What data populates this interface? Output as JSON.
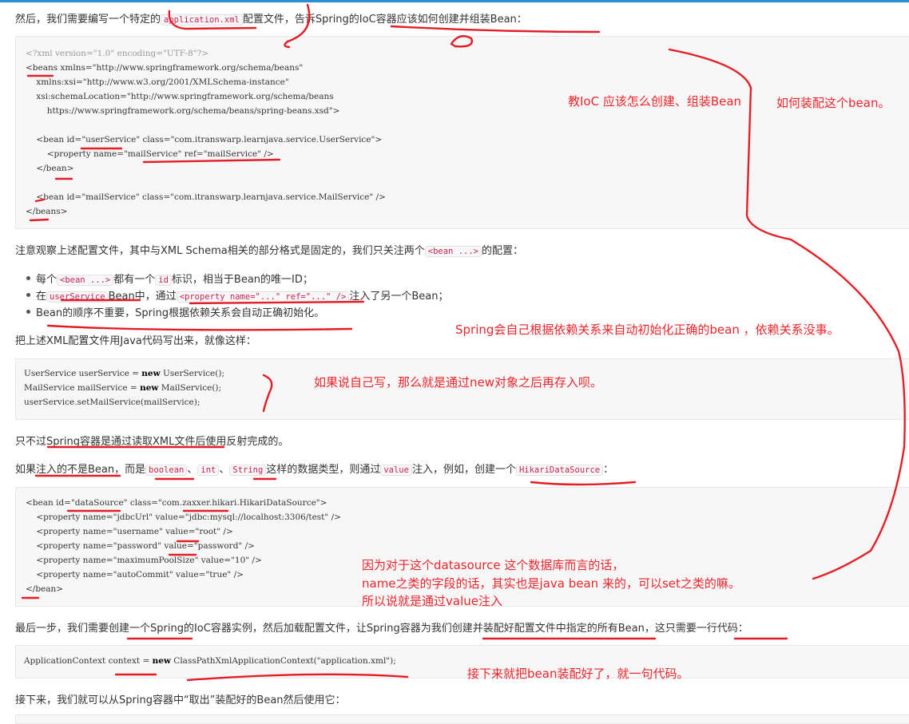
{
  "colors": {
    "accent": "#2c8fd6",
    "annotation": "#e41e26",
    "inline_code": "#c7254e"
  },
  "p1": {
    "pre": "然后，我们需要编写一个特定的",
    "code": "application.xml",
    "post": "配置文件，告诉Spring的IoC容器应该如何创建并组装Bean："
  },
  "xml1": [
    "<?xml version=\"1.0\" encoding=\"UTF-8\"?>",
    "<beans xmlns=\"http://www.springframework.org/schema/beans\"",
    "    xmlns:xsi=\"http://www.w3.org/2001/XMLSchema-instance\"",
    "    xsi:schemaLocation=\"http://www.springframework.org/schema/beans",
    "        https://www.springframework.org/schema/beans/spring-beans.xsd\">",
    "",
    "    <bean id=\"userService\" class=\"com.itranswarp.learnjava.service.UserService\">",
    "        <property name=\"mailService\" ref=\"mailService\" />",
    "    </bean>",
    "",
    "    <bean id=\"mailService\" class=\"com.itranswarp.learnjava.service.MailService\" />",
    "</beans>"
  ],
  "p2": {
    "pre": "注意观察上述配置文件，其中与XML Schema相关的部分格式是固定的，我们只关注两个",
    "code": "<bean ...>",
    "post": "的配置："
  },
  "bullets": {
    "b1": {
      "pre": "每个",
      "code1": "<bean ...>",
      "mid": "都有一个",
      "code2": "id",
      "post": "标识，相当于Bean的唯一ID；"
    },
    "b2": {
      "pre": "在",
      "code1": "userService",
      "mid": "Bean中，通过",
      "code2": "<property name=\"...\" ref=\"...\" />",
      "post": "注入了另一个Bean；"
    },
    "b3": {
      "text": "Bean的顺序不重要，Spring根据依赖关系会自动正确初始化。"
    }
  },
  "p3": {
    "text": "把上述XML配置文件用Java代码写出来，就像这样："
  },
  "java1": {
    "l1": {
      "a": "UserService userService = ",
      "kw": "new",
      "b": " UserService();"
    },
    "l2": {
      "a": "MailService mailService = ",
      "kw": "new",
      "b": " MailService();"
    },
    "l3": {
      "a": "userService.setMailService(mailService);"
    }
  },
  "p4": {
    "text": "只不过Spring容器是通过读取XML文件后使用反射完成的。"
  },
  "p5": {
    "pre": "如果注入的不是Bean，而是",
    "c1": "boolean",
    "s1": "、",
    "c2": "int",
    "s2": "、",
    "c3": "String",
    "mid": "这样的数据类型，则通过",
    "c4": "value",
    "mid2": "注入，例如，创建一个",
    "c5": "HikariDataSource",
    "post": "："
  },
  "xml2": [
    "<bean id=\"dataSource\" class=\"com.zaxxer.hikari.HikariDataSource\">",
    "    <property name=\"jdbcUrl\" value=\"jdbc:mysql://localhost:3306/test\" />",
    "    <property name=\"username\" value=\"root\" />",
    "    <property name=\"password\" value=\"password\" />",
    "    <property name=\"maximumPoolSize\" value=\"10\" />",
    "    <property name=\"autoCommit\" value=\"true\" />",
    "</bean>"
  ],
  "p6": {
    "text": "最后一步，我们需要创建一个Spring的IoC容器实例，然后加载配置文件，让Spring容器为我们创建并装配好配置文件中指定的所有Bean，这只需要一行代码："
  },
  "java2": {
    "a": "ApplicationContext context = ",
    "kw": "new",
    "b": " ClassPathXmlApplicationContext(\"application.xml\");"
  },
  "p7": {
    "text": "接下来，我们就可以从Spring容器中“取出”装配好的Bean然后使用它："
  },
  "notes": {
    "n1": "教IoC 应该怎么创建、组装Bean",
    "n2": "如何装配这个bean。",
    "n3": "Spring会自己根据依赖关系来自动初始化正确的bean ，依赖关系没事。",
    "n4": "如果说自己写，那么就是通过new对象之后再存入呗。",
    "n5": "因为对于这个datasource  这个数据库而言的话，",
    "n6": "name之类的字段的话，其实也是java bean 来的，可以set之类的嘛。",
    "n7": "所以说就是通过value注入",
    "n8": "接下来就把bean装配好了，就一句代码。"
  }
}
